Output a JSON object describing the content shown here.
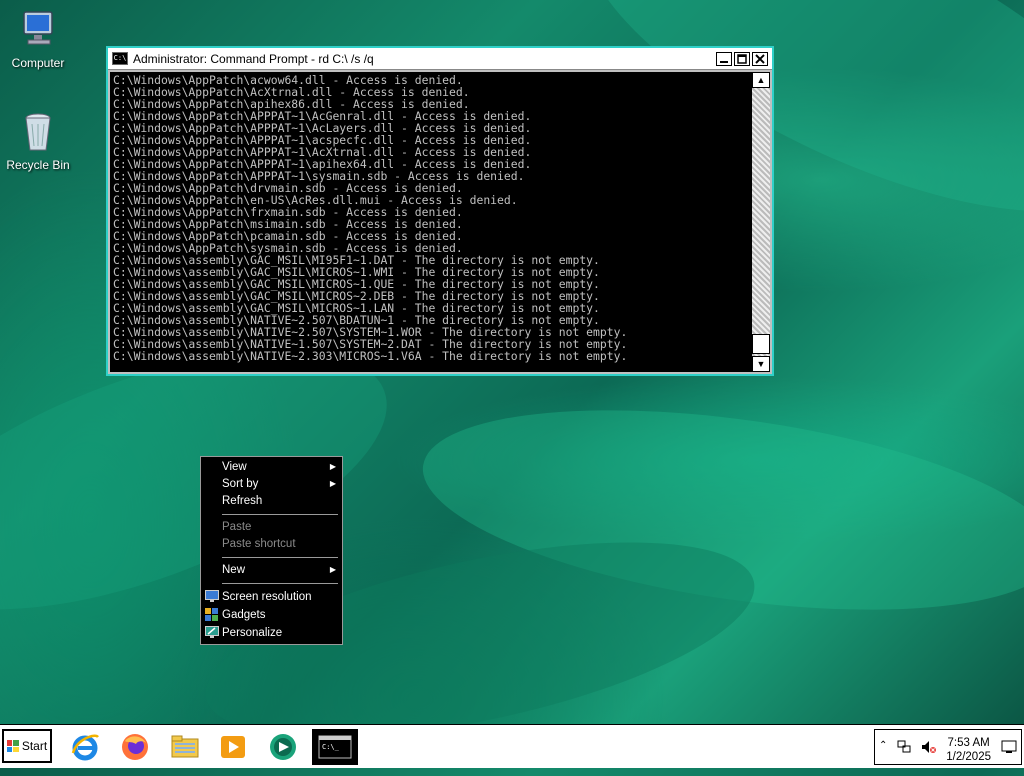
{
  "desktop": {
    "icons": [
      {
        "label": "Computer",
        "icon": "computer-icon"
      },
      {
        "label": "Recycle Bin",
        "icon": "recycle-bin-icon"
      }
    ]
  },
  "cmd_window": {
    "title": "Administrator:  Command Prompt - rd  C:\\ /s /q",
    "icon": "cmd-icon",
    "lines": [
      "C:\\Windows\\AppPatch\\acwow64.dll - Access is denied.",
      "C:\\Windows\\AppPatch\\AcXtrnal.dll - Access is denied.",
      "C:\\Windows\\AppPatch\\apihex86.dll - Access is denied.",
      "C:\\Windows\\AppPatch\\APPPAT~1\\AcGenral.dll - Access is denied.",
      "C:\\Windows\\AppPatch\\APPPAT~1\\AcLayers.dll - Access is denied.",
      "C:\\Windows\\AppPatch\\APPPAT~1\\acspecfc.dll - Access is denied.",
      "C:\\Windows\\AppPatch\\APPPAT~1\\AcXtrnal.dll - Access is denied.",
      "C:\\Windows\\AppPatch\\APPPAT~1\\apihex64.dll - Access is denied.",
      "C:\\Windows\\AppPatch\\APPPAT~1\\sysmain.sdb - Access is denied.",
      "C:\\Windows\\AppPatch\\drvmain.sdb - Access is denied.",
      "C:\\Windows\\AppPatch\\en-US\\AcRes.dll.mui - Access is denied.",
      "C:\\Windows\\AppPatch\\frxmain.sdb - Access is denied.",
      "C:\\Windows\\AppPatch\\msimain.sdb - Access is denied.",
      "C:\\Windows\\AppPatch\\pcamain.sdb - Access is denied.",
      "C:\\Windows\\AppPatch\\sysmain.sdb - Access is denied.",
      "C:\\Windows\\assembly\\GAC_MSIL\\MI95F1~1.DAT - The directory is not empty.",
      "C:\\Windows\\assembly\\GAC_MSIL\\MICROS~1.WMI - The directory is not empty.",
      "C:\\Windows\\assembly\\GAC_MSIL\\MICROS~1.QUE - The directory is not empty.",
      "C:\\Windows\\assembly\\GAC_MSIL\\MICROS~2.DEB - The directory is not empty.",
      "C:\\Windows\\assembly\\GAC_MSIL\\MICROS~1.LAN - The directory is not empty.",
      "C:\\Windows\\assembly\\NATIVE~2.507\\BDATUN~1 - The directory is not empty.",
      "C:\\Windows\\assembly\\NATIVE~2.507\\SYSTEM~1.WOR - The directory is not empty.",
      "C:\\Windows\\assembly\\NATIVE~1.507\\SYSTEM~2.DAT - The directory is not empty.",
      "C:\\Windows\\assembly\\NATIVE~2.303\\MICROS~1.V6A - The directory is not empty."
    ]
  },
  "context_menu": {
    "items": [
      {
        "label": "View",
        "submenu": true,
        "enabled": true
      },
      {
        "label": "Sort by",
        "submenu": true,
        "enabled": true
      },
      {
        "label": "Refresh",
        "submenu": false,
        "enabled": true
      },
      {
        "label": "Paste",
        "submenu": false,
        "enabled": false
      },
      {
        "label": "Paste shortcut",
        "submenu": false,
        "enabled": false
      },
      {
        "label": "New",
        "submenu": true,
        "enabled": true
      },
      {
        "label": "Screen resolution",
        "submenu": false,
        "enabled": true,
        "icon": "screen-resolution-icon"
      },
      {
        "label": "Gadgets",
        "submenu": false,
        "enabled": true,
        "icon": "gadgets-icon"
      },
      {
        "label": "Personalize",
        "submenu": false,
        "enabled": true,
        "icon": "personalize-icon"
      }
    ]
  },
  "taskbar": {
    "start_label": "Start",
    "pinned": [
      "internet-explorer-icon",
      "firefox-icon",
      "file-explorer-icon",
      "media-player-icon",
      "media-center-icon",
      "command-prompt-icon"
    ],
    "clock_time": "7:53 AM",
    "clock_date": "1/2/2025",
    "tray_icons": [
      "show-hidden-icons-chevron-icon",
      "network-icon",
      "volume-muted-icon",
      "show-desktop-icon"
    ]
  }
}
